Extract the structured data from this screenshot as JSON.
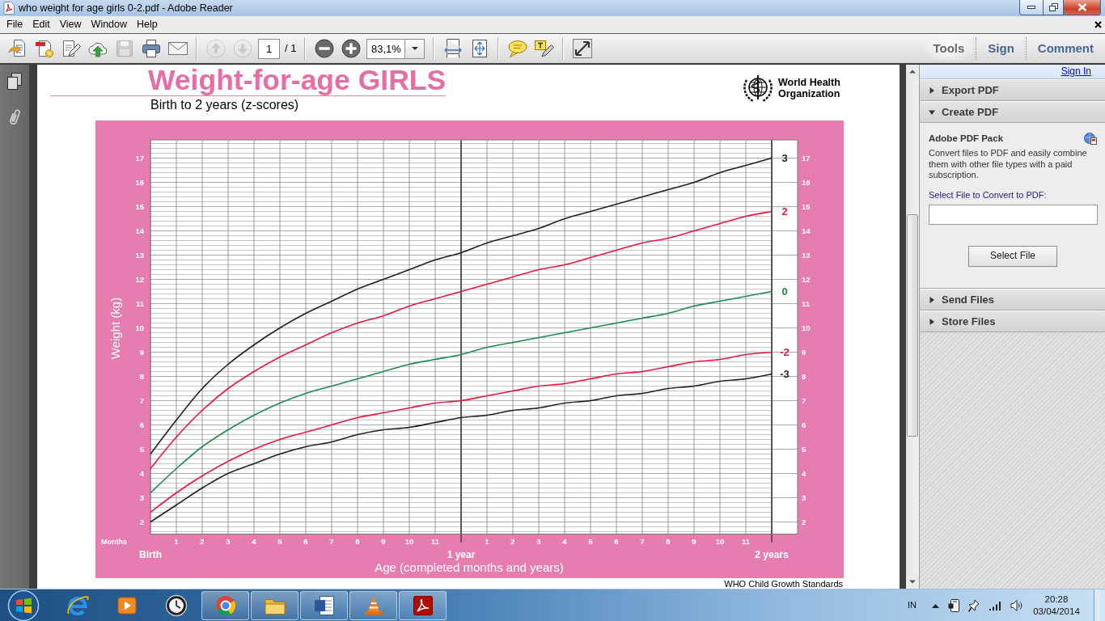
{
  "window": {
    "title": "who weight for age girls 0-2.pdf - Adobe Reader"
  },
  "menu": [
    {
      "label": "File"
    },
    {
      "label": "Edit"
    },
    {
      "label": "View"
    },
    {
      "label": "Window"
    },
    {
      "label": "Help"
    }
  ],
  "toolbar": {
    "file_buttons": [
      {
        "kind": "create",
        "disabled": false
      },
      {
        "kind": "convert",
        "disabled": false
      },
      {
        "kind": "edit",
        "disabled": false
      },
      {
        "kind": "upload",
        "disabled": false
      },
      {
        "kind": "save",
        "disabled": true
      },
      {
        "kind": "print",
        "disabled": false
      },
      {
        "kind": "email",
        "disabled": false
      }
    ],
    "page_buttons": [
      {
        "kind": "previous",
        "disabled": true
      },
      {
        "kind": "next",
        "disabled": true
      }
    ],
    "page": "1",
    "page_total": "/ 1",
    "zoom_buttons": [
      {
        "kind": "zoom_out",
        "disabled": false
      },
      {
        "kind": "zoom_in",
        "disabled": false
      }
    ],
    "zoom": "83,1%",
    "view_buttons": [
      {
        "kind": "fit_width",
        "disabled": false
      },
      {
        "kind": "fit_page",
        "disabled": false
      }
    ],
    "comment_buttons": [
      {
        "kind": "note",
        "disabled": false
      },
      {
        "kind": "highlight",
        "disabled": false
      }
    ],
    "mode_buttons": [
      {
        "kind": "full_screen",
        "disabled": false
      }
    ],
    "panes": [
      {
        "label": "Tools",
        "selected": true
      },
      {
        "label": "Sign",
        "selected": false
      },
      {
        "label": "Comment",
        "selected": false
      }
    ]
  },
  "document": {
    "title": "Weight-for-age GIRLS",
    "subtitle": "Birth to 2 years (z-scores)",
    "organization": "World Health Organization",
    "chart": {
      "months_label": "Months",
      "month_labels": [
        "1",
        "2",
        "3",
        "4",
        "5",
        "6",
        "7",
        "8",
        "9",
        "10",
        "11",
        "1",
        "2",
        "3",
        "4",
        "5",
        "6",
        "7",
        "8",
        "9",
        "10",
        "11"
      ],
      "right_axis_labels": [
        "17",
        "16",
        "15",
        "14",
        "13",
        "12",
        "11",
        "10",
        "9",
        "8",
        "7",
        "6",
        "5",
        "4",
        "3",
        "2"
      ],
      "chart_data": {
        "type": "line",
        "xlabel": "Age (completed months and years)",
        "ylabel": "Weight (kg)",
        "x": [
          0,
          0.0833,
          0.1667,
          0.25,
          0.3333,
          0.4167,
          0.5,
          0.5833,
          0.6667,
          0.75,
          0.8333,
          0.9167,
          1,
          1.0833,
          1.1667,
          1.25,
          1.3333,
          1.4167,
          1.5,
          1.5833,
          1.6667,
          1.75,
          1.8333,
          1.9167,
          2
        ],
        "xlim": [
          0,
          2.0833
        ],
        "ylim": [
          1.5,
          17.75
        ],
        "grid": true,
        "ref_lines": [
          {
            "axis": "x",
            "value": 1
          },
          {
            "axis": "x",
            "value": 2
          }
        ],
        "xticks": [
          {
            "value": 0,
            "label": "Birth"
          },
          {
            "value": 1,
            "label": "1 year"
          },
          {
            "value": 2,
            "label": "2 years"
          }
        ],
        "yticks": [
          2,
          3,
          4,
          5,
          6,
          7,
          8,
          9,
          10,
          11,
          12,
          13,
          14,
          15,
          16,
          17
        ],
        "series": [
          {
            "name": "3",
            "color": "#231f20",
            "values": [
              4.8,
              6.2,
              7.5,
              8.5,
              9.3,
              10.0,
              10.6,
              11.1,
              11.6,
              12.0,
              12.4,
              12.8,
              13.1,
              13.5,
              13.8,
              14.1,
              14.5,
              14.8,
              15.1,
              15.4,
              15.7,
              16.0,
              16.4,
              16.7,
              17.0
            ]
          },
          {
            "name": "2",
            "color": "#e8173f",
            "values": [
              4.2,
              5.5,
              6.6,
              7.5,
              8.2,
              8.8,
              9.3,
              9.8,
              10.2,
              10.5,
              10.9,
              11.2,
              11.5,
              11.8,
              12.1,
              12.4,
              12.6,
              12.9,
              13.2,
              13.5,
              13.7,
              14.0,
              14.3,
              14.6,
              14.8
            ]
          },
          {
            "name": "0",
            "color": "#1d8a4e",
            "values": [
              3.2,
              4.2,
              5.1,
              5.8,
              6.4,
              6.9,
              7.3,
              7.6,
              7.9,
              8.2,
              8.5,
              8.7,
              8.9,
              9.2,
              9.4,
              9.6,
              9.8,
              10.0,
              10.2,
              10.4,
              10.6,
              10.9,
              11.1,
              11.3,
              11.5
            ]
          },
          {
            "name": "-2",
            "color": "#e8173f",
            "values": [
              2.4,
              3.2,
              3.9,
              4.5,
              5.0,
              5.4,
              5.7,
              6.0,
              6.3,
              6.5,
              6.7,
              6.9,
              7.0,
              7.2,
              7.4,
              7.6,
              7.7,
              7.9,
              8.1,
              8.2,
              8.4,
              8.6,
              8.7,
              8.9,
              9.0
            ]
          },
          {
            "name": "-3",
            "color": "#231f20",
            "values": [
              2.0,
              2.7,
              3.4,
              4.0,
              4.4,
              4.8,
              5.1,
              5.3,
              5.6,
              5.8,
              5.9,
              6.1,
              6.3,
              6.4,
              6.6,
              6.7,
              6.9,
              7.0,
              7.2,
              7.3,
              7.5,
              7.6,
              7.8,
              7.9,
              8.1
            ]
          }
        ]
      }
    },
    "footer": "WHO Child Growth Standards"
  },
  "right_panel": {
    "sign_in": "Sign In",
    "sections": [
      {
        "title": "Export PDF",
        "expanded": false
      },
      {
        "title": "Create PDF",
        "expanded": true,
        "heading": "Adobe PDF Pack",
        "description": "Convert files to PDF and easily combine them with other file types with a paid subscription.",
        "field_label": "Select File to Convert to PDF:",
        "button": "Select File"
      },
      {
        "title": "Send Files",
        "expanded": false
      },
      {
        "title": "Store Files",
        "expanded": false
      }
    ]
  },
  "taskbar": {
    "apps": [
      {
        "kind": "browser",
        "running": false
      },
      {
        "kind": "media",
        "running": false
      },
      {
        "kind": "clock",
        "running": false
      },
      {
        "kind": "web",
        "running": true
      },
      {
        "kind": "files",
        "running": true
      },
      {
        "kind": "word",
        "running": true
      },
      {
        "kind": "cone",
        "running": true
      },
      {
        "kind": "reader",
        "running": true
      }
    ],
    "language": "IN",
    "time": "20:28",
    "date": "03/04/2014"
  }
}
